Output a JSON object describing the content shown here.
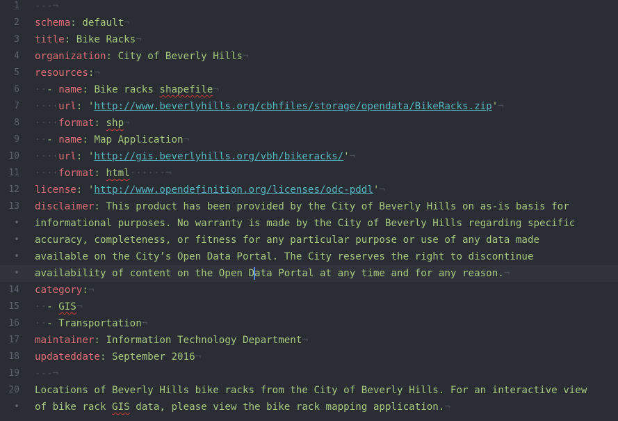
{
  "editor": {
    "lines": [
      {
        "n": "1",
        "segs": [
          [
            "inv",
            "---"
          ],
          [
            "inv",
            "¬"
          ]
        ]
      },
      {
        "n": "2",
        "segs": [
          [
            "key",
            "schema"
          ],
          [
            "str",
            ": default"
          ],
          [
            "inv",
            "¬"
          ]
        ]
      },
      {
        "n": "3",
        "segs": [
          [
            "key",
            "title"
          ],
          [
            "str",
            ": Bike Racks"
          ],
          [
            "inv",
            "¬"
          ]
        ]
      },
      {
        "n": "4",
        "segs": [
          [
            "key",
            "organization"
          ],
          [
            "str",
            ": City of Beverly Hills"
          ],
          [
            "inv",
            "¬"
          ]
        ]
      },
      {
        "n": "5",
        "segs": [
          [
            "key",
            "resources"
          ],
          [
            "str",
            ":"
          ],
          [
            "inv",
            "¬"
          ]
        ]
      },
      {
        "n": "6",
        "segs": [
          [
            "inv",
            "··"
          ],
          [
            "str",
            "- "
          ],
          [
            "key",
            "name"
          ],
          [
            "str",
            ": Bike racks "
          ],
          [
            "spell",
            "shapefile"
          ],
          [
            "inv",
            "¬"
          ]
        ]
      },
      {
        "n": "7",
        "segs": [
          [
            "inv",
            "····"
          ],
          [
            "key",
            "url"
          ],
          [
            "str",
            ": '"
          ],
          [
            "url",
            "http://www.beverlyhills.org/cbhfiles/storage/opendata/BikeRacks.zip"
          ],
          [
            "str",
            "'"
          ],
          [
            "inv",
            "¬"
          ]
        ]
      },
      {
        "n": "8",
        "segs": [
          [
            "inv",
            "····"
          ],
          [
            "key",
            "format"
          ],
          [
            "str",
            ": "
          ],
          [
            "spell",
            "shp"
          ],
          [
            "inv",
            "¬"
          ]
        ]
      },
      {
        "n": "9",
        "segs": [
          [
            "inv",
            "··"
          ],
          [
            "str",
            "- "
          ],
          [
            "key",
            "name"
          ],
          [
            "str",
            ": Map Application"
          ],
          [
            "inv",
            "¬"
          ]
        ]
      },
      {
        "n": "10",
        "segs": [
          [
            "inv",
            "····"
          ],
          [
            "key",
            "url"
          ],
          [
            "str",
            ": '"
          ],
          [
            "url",
            "http://gis.beverlyhills.org/vbh/bikeracks/"
          ],
          [
            "str",
            "'"
          ],
          [
            "inv",
            "¬"
          ]
        ]
      },
      {
        "n": "11",
        "segs": [
          [
            "inv",
            "····"
          ],
          [
            "key",
            "format"
          ],
          [
            "str",
            ": "
          ],
          [
            "spell",
            "html"
          ],
          [
            "inv",
            "······¬"
          ]
        ]
      },
      {
        "n": "12",
        "segs": [
          [
            "key",
            "license"
          ],
          [
            "str",
            ": '"
          ],
          [
            "url",
            "http://www.opendefinition.org/licenses/odc-pddl"
          ],
          [
            "str",
            "'"
          ],
          [
            "inv",
            "¬"
          ]
        ]
      },
      {
        "n": "13",
        "segs": [
          [
            "key",
            "disclaimer"
          ],
          [
            "str",
            ": This product has been provided by the City of Beverly Hills on as-is basis for"
          ]
        ]
      },
      {
        "n": "•",
        "segs": [
          [
            "str",
            "informational purposes. No warranty is made by the City of Beverly Hills regarding specific"
          ]
        ]
      },
      {
        "n": "•",
        "segs": [
          [
            "str",
            "accuracy, completeness, or fitness for any particular purpose or use of any data made"
          ]
        ]
      },
      {
        "n": "•",
        "segs": [
          [
            "str",
            "available on the City’s Open Data Portal. The City reserves the right to discontinue"
          ]
        ]
      },
      {
        "n": "•",
        "current": true,
        "segs": [
          [
            "str",
            "availability of content on the Open D"
          ],
          [
            "cursor",
            ""
          ],
          [
            "str",
            "ata Portal at any time and for any reason."
          ],
          [
            "inv",
            "¬"
          ]
        ]
      },
      {
        "n": "14",
        "segs": [
          [
            "key",
            "category"
          ],
          [
            "str",
            ":"
          ],
          [
            "inv",
            "¬"
          ]
        ]
      },
      {
        "n": "15",
        "segs": [
          [
            "inv",
            "··"
          ],
          [
            "str",
            "- "
          ],
          [
            "spell",
            "GIS"
          ],
          [
            "inv",
            "¬"
          ]
        ]
      },
      {
        "n": "16",
        "segs": [
          [
            "inv",
            "··"
          ],
          [
            "str",
            "- Transportation"
          ],
          [
            "inv",
            "¬"
          ]
        ]
      },
      {
        "n": "17",
        "segs": [
          [
            "key",
            "maintainer"
          ],
          [
            "str",
            ": Information Technology Department"
          ],
          [
            "inv",
            "¬"
          ]
        ]
      },
      {
        "n": "18",
        "segs": [
          [
            "key",
            "updateddate"
          ],
          [
            "str",
            ": September 2016"
          ],
          [
            "inv",
            "¬"
          ]
        ]
      },
      {
        "n": "19",
        "segs": [
          [
            "inv",
            "---"
          ],
          [
            "inv",
            "¬"
          ]
        ]
      },
      {
        "n": "20",
        "segs": [
          [
            "str",
            "Locations of Beverly Hills bike racks from the City of Beverly Hills. For an interactive view"
          ]
        ]
      },
      {
        "n": "•",
        "segs": [
          [
            "str",
            "of bike rack "
          ],
          [
            "spell",
            "GIS"
          ],
          [
            "str",
            " data, please view the bike rack mapping application."
          ],
          [
            "inv",
            "¬"
          ]
        ]
      }
    ]
  },
  "colors": {
    "background": "#2a2d33",
    "current_line": "#30343a",
    "key": "#e06c75",
    "string": "#a8c97f",
    "url": "#56b6c2",
    "invisible": "#4a505a",
    "gutter": "#5d6470",
    "spellcheck": "#d33a3a",
    "cursor": "#528bff"
  }
}
